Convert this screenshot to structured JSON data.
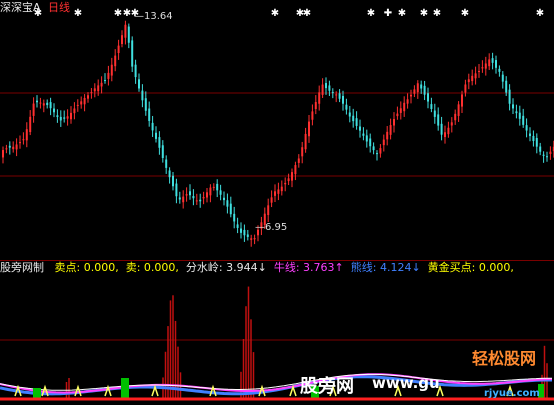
{
  "header": {
    "stock_name": "深深宝A",
    "period": "日线"
  },
  "price_panel": {
    "high_label": "13.64",
    "low_label": "6.95",
    "signal_glyphs": [
      "◆",
      "◆",
      "✚",
      "✱"
    ]
  },
  "indicator_panel": {
    "name": "股旁网制",
    "items": [
      {
        "label": "卖点:",
        "value": "0.000,",
        "color": "#ffff00"
      },
      {
        "label": "卖:",
        "value": "0.000,",
        "color": "#ffff00"
      },
      {
        "label": "分水岭:",
        "value": "3.944",
        "arrow": "↓",
        "color": "#e8e8e8"
      },
      {
        "label": "牛线:",
        "value": "3.763",
        "arrow": "↑",
        "color": "#ff40ff"
      },
      {
        "label": "熊线:",
        "value": "4.124",
        "arrow": "↓",
        "color": "#4080ff"
      },
      {
        "label": "黄金买点:",
        "value": "0.000,",
        "color": "#ffff00"
      }
    ]
  },
  "watermark": {
    "text1": "股旁网",
    "text2": "www.gu",
    "text3": "rjyue.com",
    "logo": "轻松股网"
  },
  "colors": {
    "up": "#ff3030",
    "down": "#40e0e0",
    "grid": "#7a0000",
    "bull_line": "#ff40ff",
    "bear_line": "#4080ff",
    "divide_line": "#ffffff",
    "buy_bar": "#00c000",
    "sell_spike": "#c01010",
    "marker": "#ffff60"
  }
}
